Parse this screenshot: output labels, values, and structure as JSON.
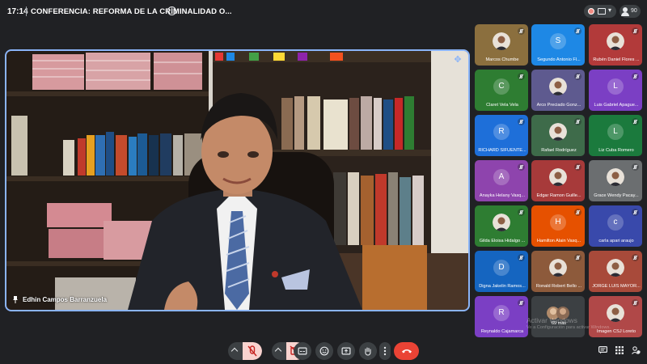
{
  "header": {
    "time": "17:14",
    "meeting_title": "CONFERENCIA: REFORMA DE LA CRIMINALIDAD O...",
    "participants_count": "90"
  },
  "main_speaker": {
    "name": "Edhin Campos Barranzuela"
  },
  "participants": [
    {
      "name": "Marcos Chumbe",
      "initial": "",
      "color": "#8b6f3e",
      "photo": true
    },
    {
      "name": "Segundo Antonio Fl...",
      "initial": "S",
      "color": "#1e88e5",
      "photo": false
    },
    {
      "name": "Rubén Daniel Flores ...",
      "initial": "",
      "color": "#b23a3a",
      "photo": true
    },
    {
      "name": "Claret Vela Vela",
      "initial": "C",
      "color": "#2e7d32",
      "photo": false
    },
    {
      "name": "Arco Preciado Gonz...",
      "initial": "",
      "color": "#5e5a8f",
      "photo": true
    },
    {
      "name": "Luis Gabriel Apague...",
      "initial": "L",
      "color": "#7b3fc4",
      "photo": false
    },
    {
      "name": "RICHARD SIFUENTE...",
      "initial": "R",
      "color": "#1e6fd9",
      "photo": false
    },
    {
      "name": "Rafael Rodríguez",
      "initial": "",
      "color": "#3e6b4a",
      "photo": true
    },
    {
      "name": "Liz Cuba Romero",
      "initial": "L",
      "color": "#1b7a3d",
      "photo": false
    },
    {
      "name": "Anayka Helany Vasq...",
      "initial": "A",
      "color": "#8e44ad",
      "photo": false
    },
    {
      "name": "Edgar Ramon Guille...",
      "initial": "",
      "color": "#a73a3a",
      "photo": true
    },
    {
      "name": "Grace Wendy Pacay...",
      "initial": "",
      "color": "#6b6e70",
      "photo": true
    },
    {
      "name": "Gilda Eloisa Hidalgo ...",
      "initial": "",
      "color": "#2e7d32",
      "photo": true
    },
    {
      "name": "Hamilton Alain Vasq...",
      "initial": "H",
      "color": "#e65100",
      "photo": false
    },
    {
      "name": "carla apari araujo",
      "initial": "c",
      "color": "#3949ab",
      "photo": false
    },
    {
      "name": "Digna Jakelin Ramos...",
      "initial": "D",
      "color": "#1565c0",
      "photo": false
    },
    {
      "name": "Ronald Robert Bello ...",
      "initial": "",
      "color": "#8d5a3b",
      "photo": true
    },
    {
      "name": "JORGE LUIS MAYOR...",
      "initial": "",
      "color": "#a84a3a",
      "photo": true
    },
    {
      "name": "Reynaldo Cajamarca",
      "initial": "R",
      "color": "#7b3fc4",
      "photo": false
    },
    {
      "name": "69 más",
      "initial": "",
      "color": "#3c4043",
      "photo": true
    },
    {
      "name": "Imagen CSJ Loreto",
      "initial": "",
      "color": "#b04848",
      "photo": true
    }
  ],
  "watermark": {
    "line1": "Activar Windows",
    "line2": "Ve a Configuración para activar Windows."
  },
  "controls": {
    "mic_icon": "mic-off-icon",
    "camera_icon": "camera-off-icon",
    "captions_icon": "closed-captions-icon",
    "emoji_icon": "emoji-icon",
    "present_icon": "present-screen-icon",
    "hand_icon": "raise-hand-icon",
    "more_icon": "more-vert-icon",
    "leave_icon": "end-call-icon",
    "leave_color": "#ea4335"
  }
}
